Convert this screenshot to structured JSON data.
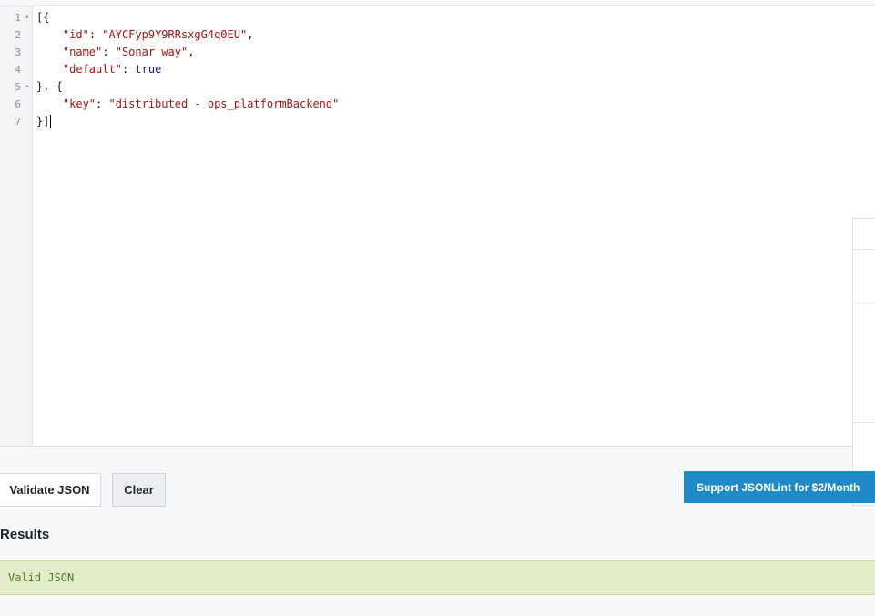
{
  "editor": {
    "line_numbers": [
      "1",
      "2",
      "3",
      "4",
      "5",
      "6",
      "7"
    ],
    "fold_marker": "▾",
    "lines": [
      {
        "text": "[{"
      },
      {
        "indent": "    ",
        "key": "\"id\"",
        "sep": ": ",
        "value": "\"AYCFyp9Y9RRsxgG4q0EU\"",
        "tail": ","
      },
      {
        "indent": "    ",
        "key": "\"name\"",
        "sep": ": ",
        "value": "\"Sonar way\"",
        "tail": ","
      },
      {
        "indent": "    ",
        "key": "\"default\"",
        "sep": ": ",
        "value": "true",
        "tail": ""
      },
      {
        "text": "}, {"
      },
      {
        "indent": "    ",
        "key": "\"key\"",
        "sep": ": ",
        "value": "\"distributed - ops_platformBackend\"",
        "tail": ""
      },
      {
        "text": "}]"
      }
    ]
  },
  "actions": {
    "validate_label": "Validate JSON",
    "clear_label": "Clear",
    "support_label": "Support JSONLint for $2/Month"
  },
  "results": {
    "heading": "Results",
    "message": "Valid JSON"
  },
  "colors": {
    "accent": "#1f8ac8",
    "success_bg": "#e3ecc8",
    "success_text": "#4f7a28",
    "string": "#a31515",
    "boolean": "#1a1aa6"
  }
}
